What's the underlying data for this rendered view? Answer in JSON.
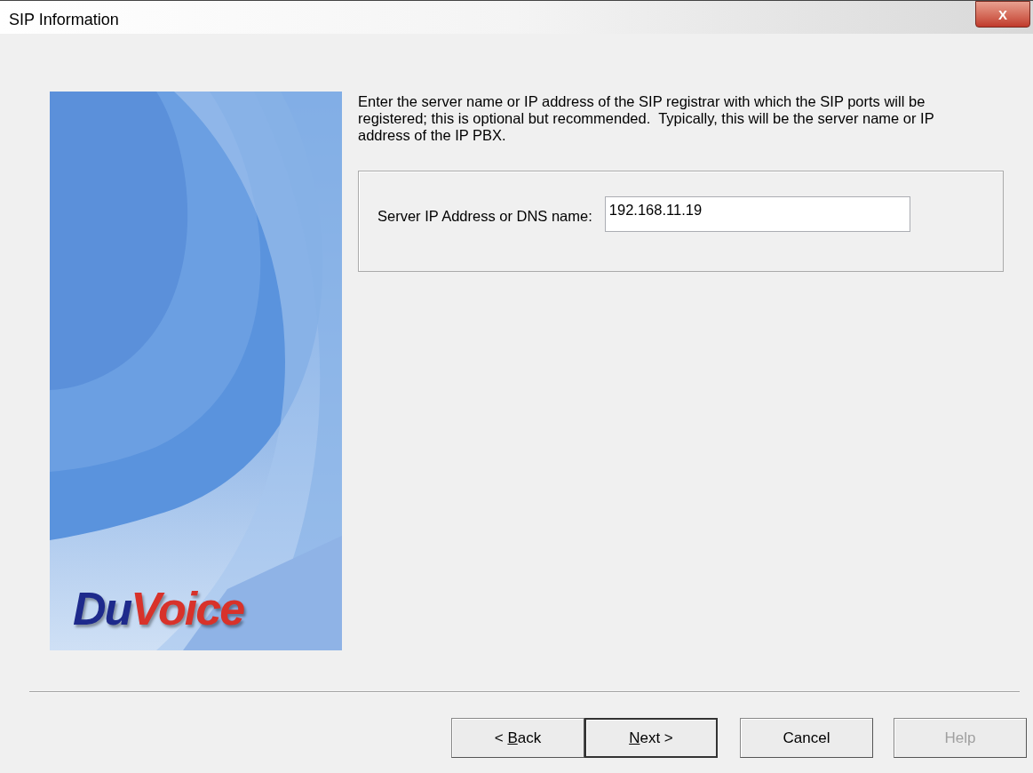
{
  "window": {
    "title": "SIP Information",
    "close_label": "X"
  },
  "side_panel": {
    "kind": "picture",
    "logo": [
      {
        "text": "Du",
        "color": "#1e2a8c"
      },
      {
        "text": "Voice",
        "color": "#d8322a"
      }
    ]
  },
  "instructions": "Enter the server name or IP address of the SIP registrar with which the SIP ports will be registered; this is optional but recommended.  Typically, this will be the server name or IP address of the IP PBX.",
  "server_field": {
    "label": "Server IP Address or DNS name:",
    "value": "192.168.11.19"
  },
  "buttons": [
    {
      "before": "< ",
      "key": "B",
      "after": "ack",
      "default": false,
      "disabled": false
    },
    {
      "key": "N",
      "after": "ext >",
      "default": true,
      "disabled": false
    },
    {
      "before": "Cancel",
      "default": false,
      "disabled": false
    },
    {
      "before": "Help",
      "default": false,
      "disabled": true
    }
  ]
}
